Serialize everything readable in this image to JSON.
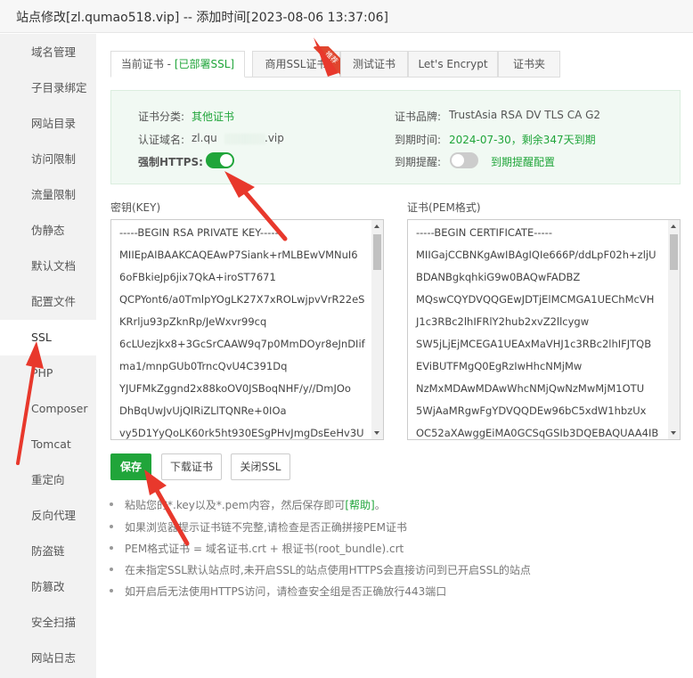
{
  "window": {
    "title": "站点修改[zl.qumao518.vip] -- 添加时间[2023-08-06 13:37:06]"
  },
  "sidebar": {
    "items": [
      {
        "label": "域名管理"
      },
      {
        "label": "子目录绑定"
      },
      {
        "label": "网站目录"
      },
      {
        "label": "访问限制"
      },
      {
        "label": "流量限制"
      },
      {
        "label": "伪静态"
      },
      {
        "label": "默认文档"
      },
      {
        "label": "配置文件"
      },
      {
        "label": "SSL"
      },
      {
        "label": "PHP"
      },
      {
        "label": "Composer"
      },
      {
        "label": "Tomcat"
      },
      {
        "label": "重定向"
      },
      {
        "label": "反向代理"
      },
      {
        "label": "防盗链"
      },
      {
        "label": "防篡改"
      },
      {
        "label": "安全扫描"
      },
      {
        "label": "网站日志"
      }
    ],
    "active_index": 8
  },
  "tabs": {
    "current_prefix": "当前证书 - ",
    "current_status": "[已部署SSL]",
    "commercial": "商用SSL证书",
    "ribbon": "推荐",
    "test": "测试证书",
    "letsencrypt": "Let's Encrypt",
    "folder": "证书夹"
  },
  "cert_info": {
    "category_label": "证书分类:",
    "category_value": "其他证书",
    "domain_label": "认证域名:",
    "domain_value": "zl.qu",
    "domain_value_tail": ".vip",
    "force_https_label": "强制HTTPS:",
    "force_https_on": true,
    "brand_label": "证书品牌:",
    "brand_value": "TrustAsia RSA DV TLS CA G2",
    "expire_label": "到期时间:",
    "expire_value": "2024-07-30，剩余347天到期",
    "reminder_label": "到期提醒:",
    "reminder_on": false,
    "reminder_config": "到期提醒配置"
  },
  "key_box": {
    "label": "密钥(KEY)",
    "lines": [
      "-----BEGIN RSA PRIVATE KEY-----",
      "MIIEpAIBAAKCAQEAwP7Siank+rMLBEwVMNuI6",
      "6oFBkieJp6jix7QkA+iroST7671",
      "QCPYont6/a0TmlpYOgLK27X7xROLwjpvVrR22eS",
      "KRrlju93pZknRp/JeWxvr99cq",
      "6cLUezjkx8+3GcSrCAAW9q7p0MmDOyr8eJnDIif",
      "ma1/mnpGUb0TrncQvU4C391Dq",
      "YJUFMkZggnd2x88koOV0JSBoqNHF/y//DmJOo",
      "DhBqUwJvUjQlRiZLlTQNRe+0IOa",
      "vy5D1YyQoLK60rk5ht930ESgPHvJmgDsEeHv3U"
    ]
  },
  "cert_box": {
    "label": "证书(PEM格式)",
    "lines": [
      "-----BEGIN CERTIFICATE-----",
      "MIIGajCCBNKgAwIBAgIQIe666P/ddLpF02h+zljU",
      "BDANBgkqhkiG9w0BAQwFADBZ",
      "MQswCQYDVQQGEwJDTjElMCMGA1UEChMcVH",
      "J1c3RBc2lhIFRlY2hub2xvZ2llcygw",
      "SW5jLjEjMCEGA1UEAxMaVHJ1c3RBc2lhIFJTQB",
      "EViBUTFMgQ0EgRzIwHhcNMjMw",
      "NzMxMDAwMDAwWhcNMjQwNzMwMjM1OTU",
      "5WjAaMRgwFgYDVQQDEw96bC5xdW1hbzUx",
      "OC52aXAwggEiMA0GCSqGSIb3DQEBAQUAA4IB"
    ]
  },
  "buttons": {
    "save": "保存",
    "download": "下载证书",
    "close_ssl": "关闭SSL"
  },
  "tips": [
    {
      "text": "粘贴您的*.key以及*.pem内容，然后保存即可",
      "link": "[帮助]",
      "suffix": "。"
    },
    {
      "text": "如果浏览器提示证书链不完整,请检查是否正确拼接PEM证书"
    },
    {
      "text": "PEM格式证书 = 域名证书.crt + 根证书(root_bundle).crt"
    },
    {
      "text": "在未指定SSL默认站点时,未开启SSL的站点使用HTTPS会直接访问到已开启SSL的站点"
    },
    {
      "text": "如开启后无法使用HTTPS访问，请检查安全组是否正确放行443端口"
    }
  ],
  "colors": {
    "accent": "#20a53a",
    "annotation_arrow": "#e8382c",
    "sidebar_bg": "#f2f2f2",
    "info_bg": "#f1f9f3"
  }
}
